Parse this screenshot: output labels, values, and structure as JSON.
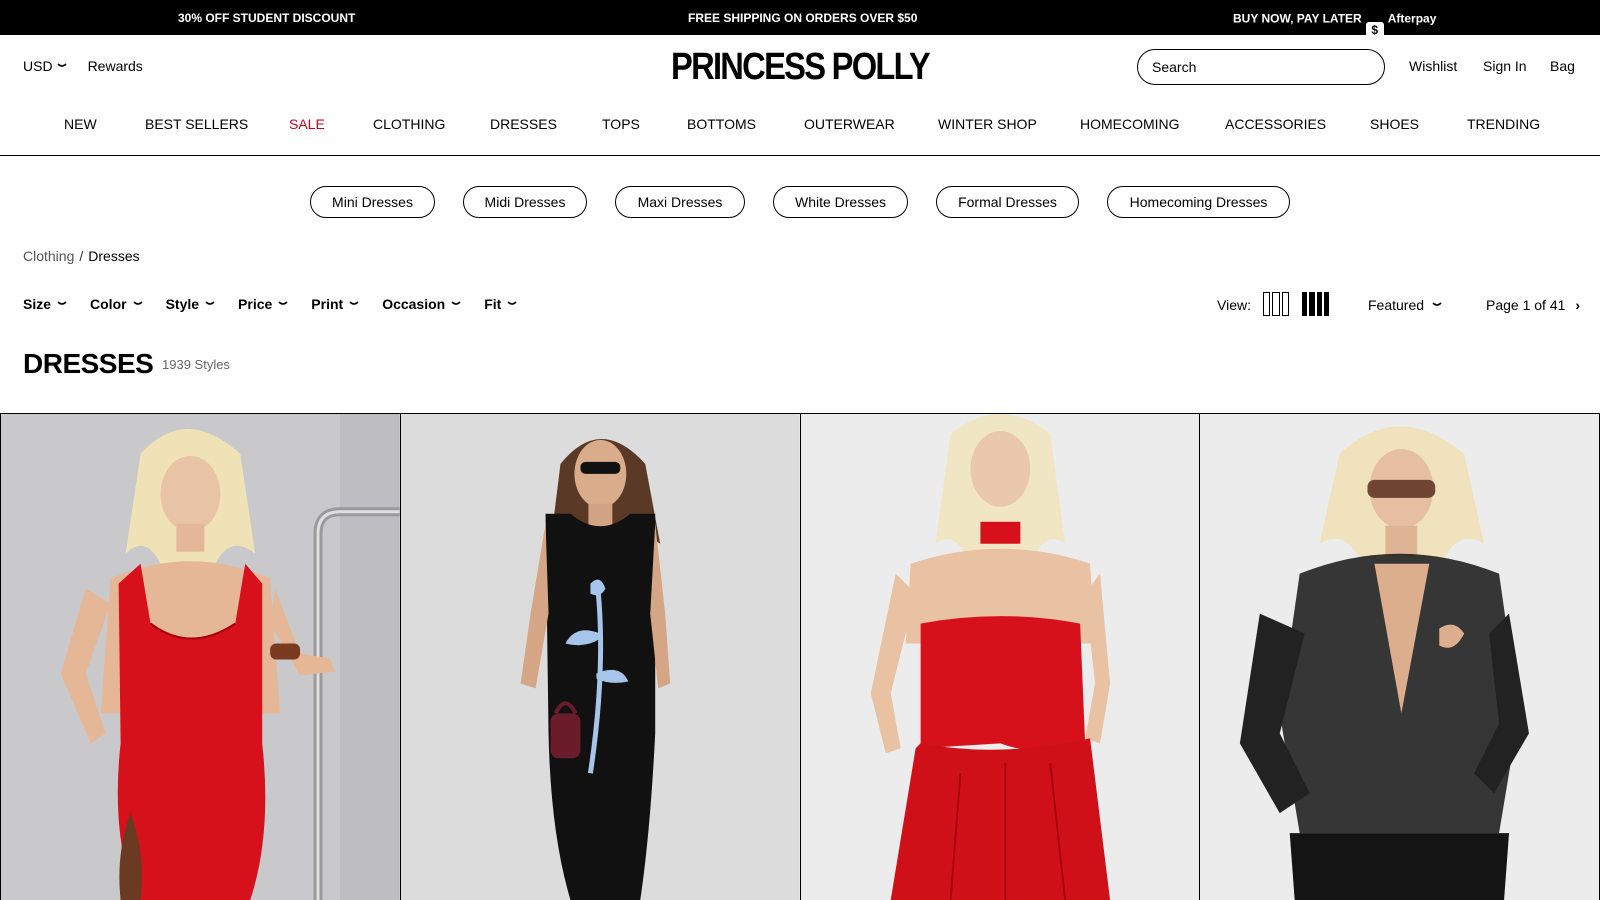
{
  "announcements": {
    "student": "30% OFF STUDENT DISCOUNT",
    "shipping": "FREE SHIPPING ON ORDERS OVER $50",
    "bnpl": "BUY NOW, PAY LATER",
    "afterpay_badge": "$",
    "afterpay": "Afterpay"
  },
  "header": {
    "currency": "USD",
    "rewards": "Rewards",
    "logo": "PRINCESS POLLY",
    "search_placeholder": "Search",
    "wishlist": "Wishlist",
    "sign_in": "Sign In",
    "bag": "Bag"
  },
  "nav": [
    "NEW",
    "BEST SELLERS",
    "SALE",
    "CLOTHING",
    "DRESSES",
    "TOPS",
    "BOTTOMS",
    "OUTERWEAR",
    "WINTER SHOP",
    "HOMECOMING",
    "ACCESSORIES",
    "SHOES",
    "TRENDING"
  ],
  "pills": [
    "Mini Dresses",
    "Midi Dresses",
    "Maxi Dresses",
    "White Dresses",
    "Formal Dresses",
    "Homecoming Dresses"
  ],
  "breadcrumb": {
    "parent": "Clothing",
    "separator": "/",
    "current": "Dresses"
  },
  "filters": [
    "Size",
    "Color",
    "Style",
    "Price",
    "Print",
    "Occasion",
    "Fit"
  ],
  "toolbar": {
    "view_label": "View:",
    "sort": "Featured",
    "pagination": "Page 1 of 41",
    "next": "›"
  },
  "listing": {
    "title": "DRESSES",
    "count": "1939 Styles"
  },
  "colors": {
    "sale": "#d0021b",
    "black": "#000000",
    "red_dress": "#d6111c"
  },
  "products": [
    {
      "image": "model in red bodycon mini dress with brown bag"
    },
    {
      "image": "model in black maxi dress with blue rose print"
    },
    {
      "image": "model in red strapless dress with red choker"
    },
    {
      "image": "model in sheer black shirt dress with sunglasses"
    }
  ]
}
